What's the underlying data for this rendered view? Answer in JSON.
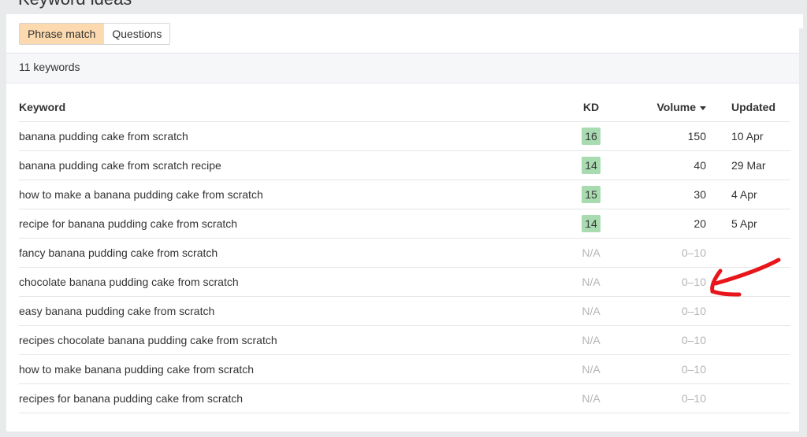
{
  "header": {
    "title_partial": "Keyword ideas"
  },
  "tabs": [
    {
      "label": "Phrase match",
      "active": true
    },
    {
      "label": "Questions",
      "active": false
    }
  ],
  "summary": {
    "count_label": "11 keywords"
  },
  "table": {
    "columns": {
      "keyword": "Keyword",
      "kd": "KD",
      "volume": "Volume",
      "updated": "Updated"
    },
    "sort": {
      "column": "volume",
      "direction": "desc"
    },
    "rows": [
      {
        "keyword": "banana pudding cake from scratch",
        "kd": "16",
        "volume": "150",
        "updated": "10 Apr"
      },
      {
        "keyword": "banana pudding cake from scratch recipe",
        "kd": "14",
        "volume": "40",
        "updated": "29 Mar"
      },
      {
        "keyword": "how to make a banana pudding cake from scratch",
        "kd": "15",
        "volume": "30",
        "updated": "4 Apr"
      },
      {
        "keyword": "recipe for banana pudding cake from scratch",
        "kd": "14",
        "volume": "20",
        "updated": "5 Apr"
      },
      {
        "keyword": "fancy banana pudding cake from scratch",
        "kd": "N/A",
        "volume": "0–10",
        "updated": ""
      },
      {
        "keyword": "chocolate banana pudding cake from scratch",
        "kd": "N/A",
        "volume": "0–10",
        "updated": ""
      },
      {
        "keyword": "easy banana pudding cake from scratch",
        "kd": "N/A",
        "volume": "0–10",
        "updated": ""
      },
      {
        "keyword": "recipes chocolate banana pudding cake from scratch",
        "kd": "N/A",
        "volume": "0–10",
        "updated": ""
      },
      {
        "keyword": "how to make banana pudding cake from scratch",
        "kd": "N/A",
        "volume": "0–10",
        "updated": ""
      },
      {
        "keyword": "recipes for banana pudding cake from scratch",
        "kd": "N/A",
        "volume": "0–10",
        "updated": ""
      }
    ]
  },
  "annotation": {
    "type": "hand-drawn-arrow",
    "color": "#e8151b",
    "points_to": "chocolate banana pudding cake from scratch"
  },
  "colors": {
    "tab_active_bg": "#fcd9ae",
    "kd_badge_bg": "#a8dcb0",
    "muted_text": "#b5b5b5",
    "page_bg": "#e9eaec"
  }
}
